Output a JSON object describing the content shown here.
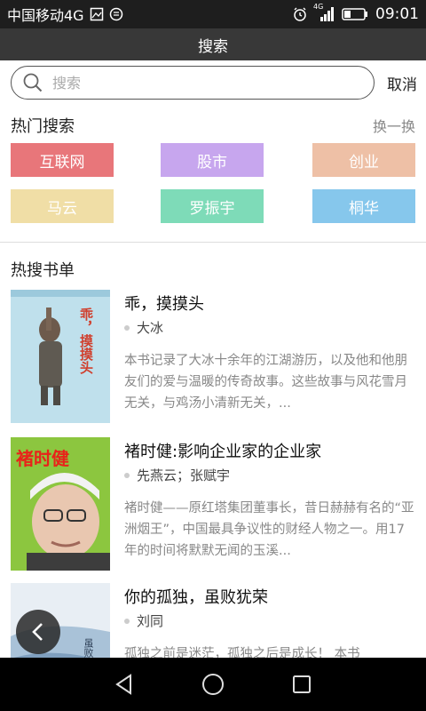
{
  "status_bar": {
    "carrier": "中国移动4G",
    "network": "4G",
    "time": "09:01"
  },
  "header": {
    "title": "搜索"
  },
  "search": {
    "placeholder": "搜索",
    "value": "",
    "cancel_label": "取消"
  },
  "hot_search": {
    "title": "热门搜索",
    "refresh_label": "换一换",
    "tags": [
      {
        "label": "互联网",
        "color": "#e8767a"
      },
      {
        "label": "股市",
        "color": "#c7a6ee"
      },
      {
        "label": "创业",
        "color": "#eec0a6"
      },
      {
        "label": "马云",
        "color": "#f0dea6"
      },
      {
        "label": "罗振宇",
        "color": "#7edbb8"
      },
      {
        "label": "桐华",
        "color": "#86c7ec"
      }
    ]
  },
  "book_list": {
    "title": "热搜书单",
    "books": [
      {
        "title": "乖，摸摸头",
        "author": "大冰",
        "description": "本书记录了大冰十余年的江湖游历，以及他和他朋友们的爱与温暖的传奇故事。这些故事与风花雪月无关，与鸡汤小清新无关，...",
        "cover_text": "乖，摸摸头"
      },
      {
        "title": "褚时健:影响企业家的企业家",
        "author": "先燕云；张赋宇",
        "description": "褚时健——原红塔集团董事长，昔日赫赫有名的“亚洲烟王”，中国最具争议性的财经人物之一。用17年的时间将默默无闻的玉溪...",
        "cover_text": "褚时健"
      },
      {
        "title": "你的孤独，虽败犹荣",
        "author": "刘同",
        "description": "孤独之前是迷茫，孤独之后是成长！ 本书",
        "cover_text": "虽败犹荣"
      }
    ]
  },
  "icons": {
    "search": "search-icon",
    "back": "chevron-left-icon",
    "nav_back": "triangle-back-icon",
    "nav_home": "circle-home-icon",
    "nav_recent": "square-recent-icon"
  }
}
